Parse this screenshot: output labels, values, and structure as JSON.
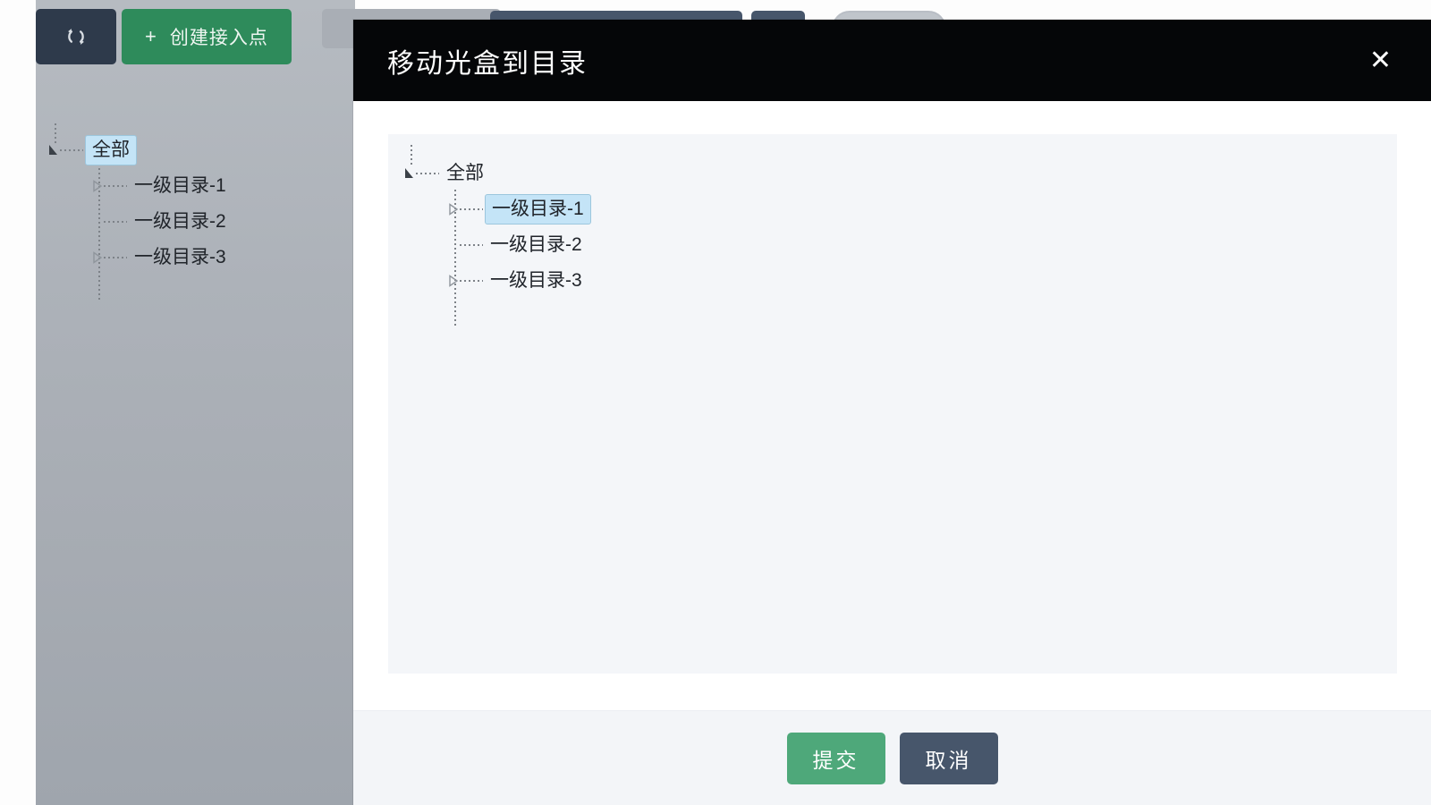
{
  "background": {
    "toolbar": {
      "refresh_icon": "refresh-icon",
      "refresh_label": "",
      "create_plus": "+",
      "create_label": "创建接入点"
    },
    "tree": {
      "root": {
        "label": "全部",
        "expanded": true,
        "selected": true
      },
      "children": [
        {
          "label": "一级目录-1",
          "expanded": false,
          "selected": false,
          "has_toggle": true
        },
        {
          "label": "一级目录-2",
          "expanded": false,
          "selected": false,
          "has_toggle": false
        },
        {
          "label": "一级目录-3",
          "expanded": false,
          "selected": false,
          "has_toggle": true
        }
      ]
    }
  },
  "modal": {
    "title": "移动光盒到目录",
    "close_icon": "✕",
    "tree": {
      "root": {
        "label": "全部",
        "expanded": true,
        "selected": false
      },
      "children": [
        {
          "label": "一级目录-1",
          "expanded": false,
          "selected": true,
          "has_toggle": true
        },
        {
          "label": "一级目录-2",
          "expanded": false,
          "selected": false,
          "has_toggle": false
        },
        {
          "label": "一级目录-3",
          "expanded": false,
          "selected": false,
          "has_toggle": true
        }
      ]
    },
    "footer": {
      "submit_label": "提交",
      "cancel_label": "取消"
    }
  },
  "colors": {
    "modal_header_bg": "#050608",
    "submit_green": "#4ea87a",
    "cancel_slate": "#47566b",
    "selected_blue": "#c4e4f7",
    "create_green": "#2e8b5b",
    "panel_bg": "#f4f6f9"
  }
}
